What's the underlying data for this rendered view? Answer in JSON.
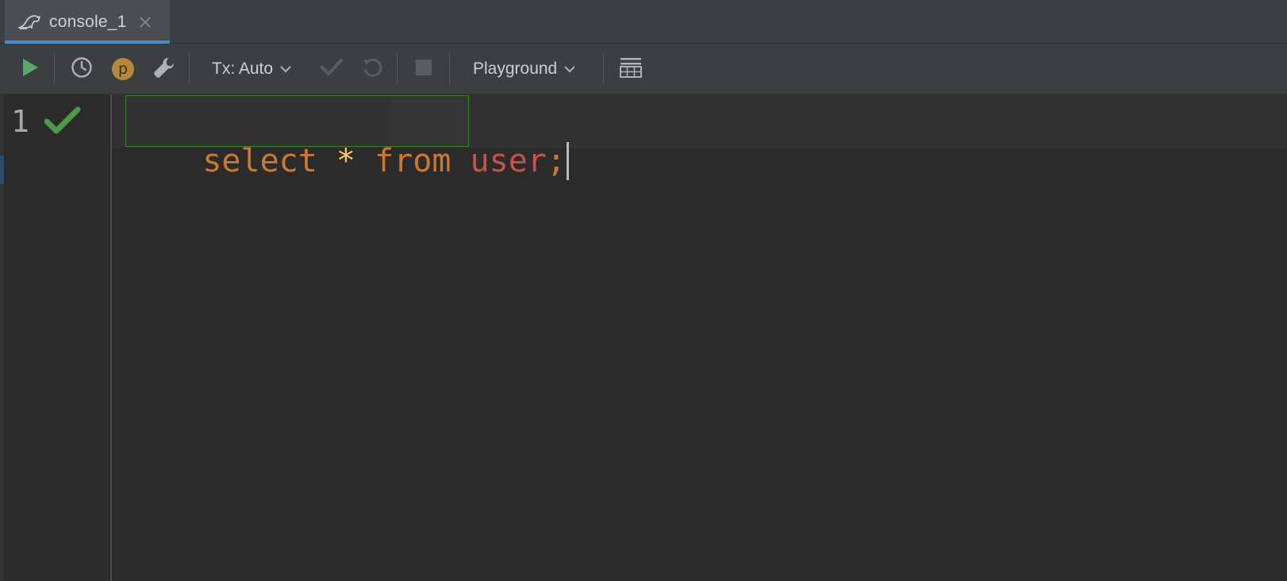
{
  "tabs": [
    {
      "label": "console_1",
      "icon": "dolphin-icon",
      "active": true,
      "closable": true
    }
  ],
  "toolbar": {
    "run_icon": "play-icon",
    "history_icon": "clock-icon",
    "profile_badge_letter": "p",
    "settings_icon": "wrench-icon",
    "tx_label": "Tx: Auto",
    "commit_icon": "check-icon",
    "rollback_icon": "undo-icon",
    "stop_icon": "stop-icon",
    "schema_label": "Playground",
    "output_icon": "table-icon"
  },
  "editor": {
    "line_number": "1",
    "line_status_icon": "green-check-icon",
    "tokens": {
      "kw_select": "select",
      "star": "*",
      "kw_from": "from",
      "ident": "user",
      "semicolon": ";"
    }
  },
  "colors": {
    "accent": "#4a88c7",
    "run_green": "#59a869",
    "keyword": "#cc7832",
    "identifier": "#c5534c",
    "operator": "#ffc66d",
    "statement_border": "#3e7f34"
  }
}
